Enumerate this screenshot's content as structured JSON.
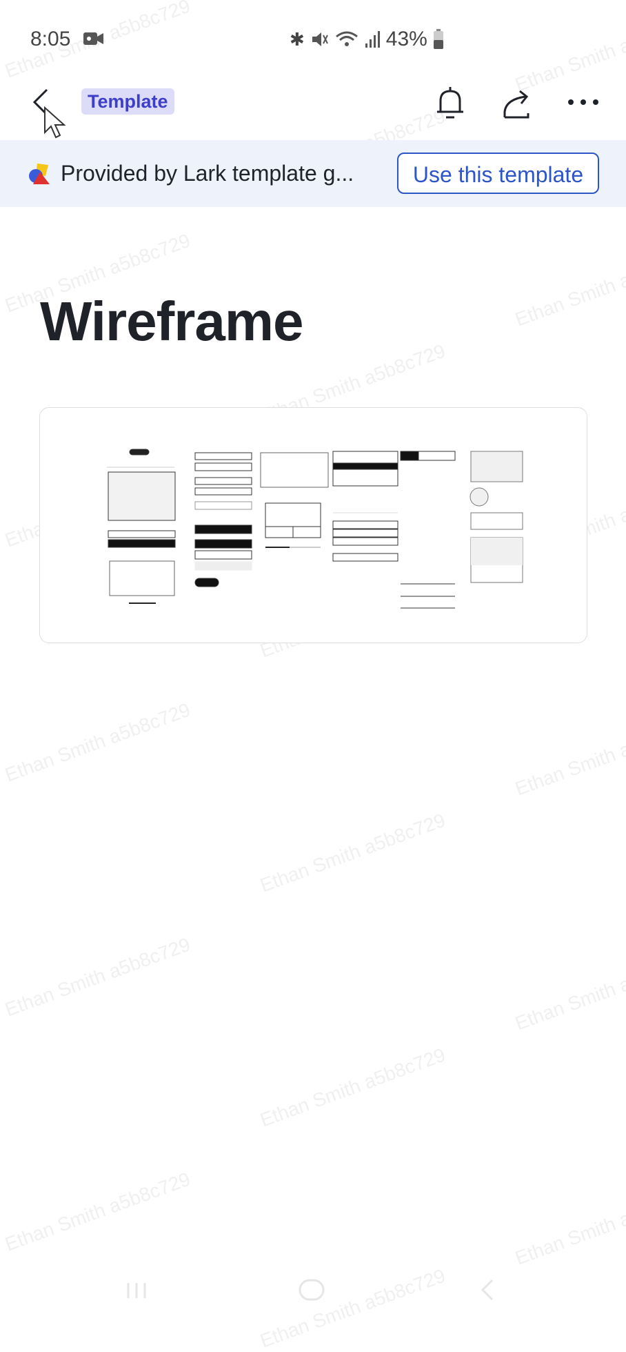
{
  "status_bar": {
    "time": "8:05",
    "battery": "43%",
    "icons": [
      "video-camera-icon",
      "bluetooth-icon",
      "mute-icon",
      "wifi-icon",
      "signal-icon",
      "battery-icon"
    ]
  },
  "header": {
    "badge": "Template",
    "icons": [
      "back-arrow-icon",
      "bell-icon",
      "share-icon",
      "more-icon"
    ]
  },
  "banner": {
    "text": "Provided by Lark template g...",
    "button": "Use this template",
    "accent": "#2c55c8"
  },
  "document": {
    "title": "Wireframe"
  },
  "watermark": "Ethan Smith a5b8c729",
  "nav_bar": {
    "icons": [
      "recent-apps-icon",
      "home-icon",
      "back-icon"
    ]
  }
}
